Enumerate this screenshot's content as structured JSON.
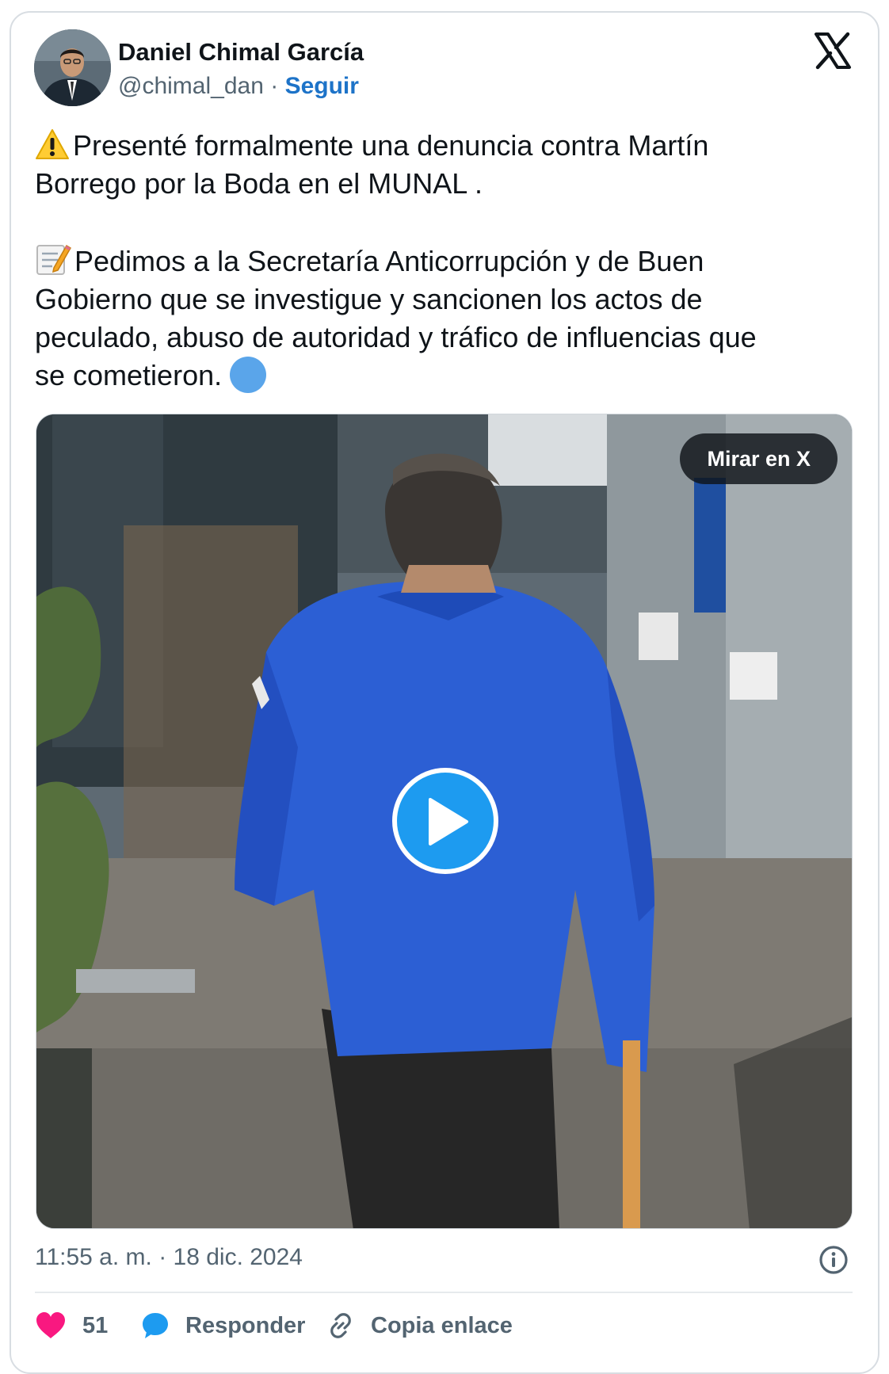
{
  "author": {
    "name": "Daniel Chimal García",
    "handle": "@chimal_dan",
    "separator": " · ",
    "follow_label": "Seguir"
  },
  "tweet": {
    "paragraph1": "Presenté formalmente una denuncia contra Martín\nBorrego por la Boda en el MUNAL .",
    "paragraph2": "Pedimos a la Secretaría Anticorrupción y de Buen\nGobierno que se investigue y sancionen los actos de\npeculado, abuso de autoridad y tráfico de influencias que\nse cometieron."
  },
  "media": {
    "watch_label": "Mirar en X"
  },
  "meta": {
    "timestamp": "11:55 a. m. · 18 dic. 2024"
  },
  "actions": {
    "likes": "51",
    "reply_label": "Responder",
    "copy_label": "Copia enlace"
  },
  "colors": {
    "accent": "#1d9bf0",
    "link": "#1d73c8",
    "like": "#f91880",
    "text_secondary": "#536471"
  },
  "icons": [
    "x-logo-icon",
    "warning-icon",
    "memo-icon",
    "blue-circle-icon",
    "play-icon",
    "info-icon",
    "heart-icon",
    "speech-bubble-icon",
    "link-icon"
  ]
}
